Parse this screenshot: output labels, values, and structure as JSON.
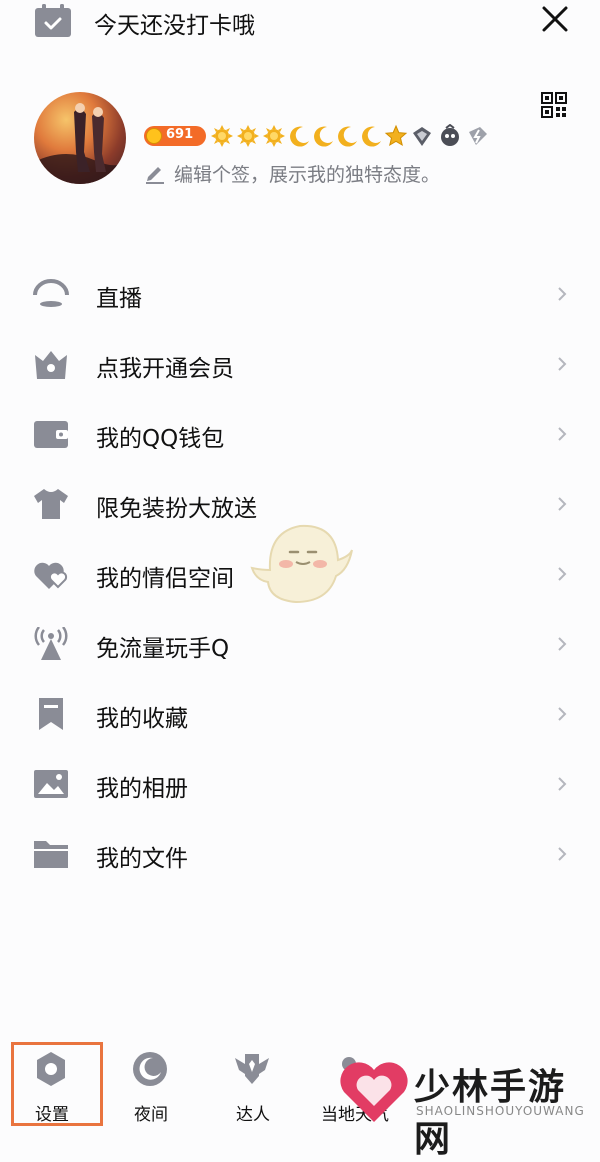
{
  "header": {
    "checkin_text": "今天还没打卡哦",
    "icons": [
      "calendar-check-icon",
      "close-icon"
    ]
  },
  "profile": {
    "level_number": "691",
    "level_icons": [
      "sun",
      "sun",
      "sun",
      "moon",
      "moon",
      "moon",
      "moon",
      "star",
      "vip-icon",
      "svip-icon",
      "speed-icon"
    ],
    "signature": "编辑个签，展示我的独特态度。",
    "qr_icon": "qr-code-icon"
  },
  "menu": {
    "items": [
      {
        "label": "直播",
        "icon": "live-icon"
      },
      {
        "label": "点我开通会员",
        "icon": "crown-icon"
      },
      {
        "label": "我的QQ钱包",
        "icon": "wallet-icon"
      },
      {
        "label": "限免装扮大放送",
        "icon": "tshirt-icon"
      },
      {
        "label": "我的情侣空间",
        "icon": "hearts-icon"
      },
      {
        "label": "免流量玩手Q",
        "icon": "signal-tower-icon"
      },
      {
        "label": "我的收藏",
        "icon": "bookmark-icon"
      },
      {
        "label": "我的相册",
        "icon": "photo-icon"
      },
      {
        "label": "我的文件",
        "icon": "folder-icon"
      }
    ]
  },
  "bottom_bar": {
    "items": [
      {
        "label": "设置",
        "icon": "settings-icon"
      },
      {
        "label": "夜间",
        "icon": "night-mode-icon"
      },
      {
        "label": "达人",
        "icon": "expert-icon"
      },
      {
        "label": "当地天气",
        "icon": "weather-icon"
      }
    ]
  },
  "watermark": {
    "title": "少林手游网",
    "subtitle": "SHAOLINSHOUYOUWANG"
  },
  "colors": {
    "icon_gray": "#8a8c96",
    "highlight": "#e9743f",
    "level_orange": "#f36b28"
  }
}
